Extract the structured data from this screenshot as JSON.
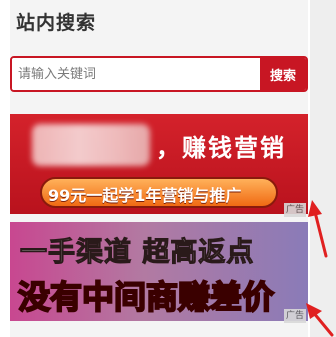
{
  "panel": {
    "title": "站内搜索"
  },
  "search": {
    "placeholder": "请输入关键词",
    "button_label": "搜索"
  },
  "banner1": {
    "headline": "，赚钱营销",
    "pill_text": "99元一起学1年营销与推广",
    "ad_label": "广告"
  },
  "banner2": {
    "line1": "一手渠道 超高返点",
    "line2": "没有中间商赚差价",
    "ad_label": "广告"
  },
  "colors": {
    "accent": "#c81623",
    "annotation_arrow": "#e02020"
  }
}
